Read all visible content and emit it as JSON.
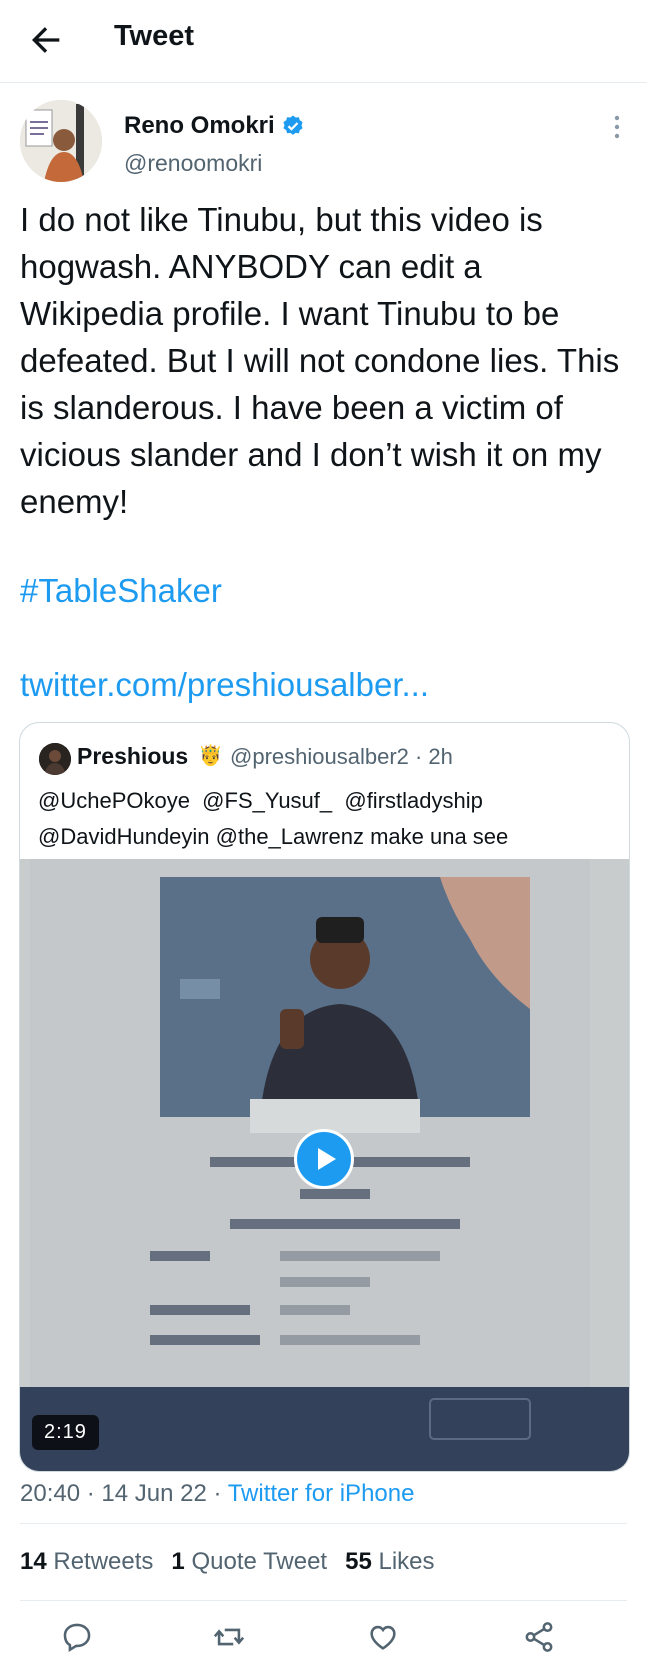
{
  "header": {
    "title": "Tweet"
  },
  "author": {
    "name": "Reno Omokri",
    "handle": "@renoomokri",
    "verified": true
  },
  "tweet": {
    "text": "I do not like Tinubu, but this video is hogwash. ANYBODY can edit a Wikipedia profile. I want Tinubu to be defeated. But I will not condone lies. This is slanderous. I have been a victim of vicious slander and I don’t wish it on my enemy!",
    "hashtag": "#TableShaker",
    "link": "twitter.com/preshiousalber..."
  },
  "quote": {
    "name": "Preshious",
    "handle_time": "@preshiousalber2 · 2h",
    "text": "@UchePOkoye  @FS_Yusuf_  @firstladyship\n@DavidHundeyin @the_Lawrenz make una see",
    "video_duration": "2:19"
  },
  "meta": {
    "time_date": "20:40 · 14 Jun 22 · ",
    "source": "Twitter for iPhone"
  },
  "stats": {
    "retweets_count": "14",
    "retweets_label": "Retweets",
    "quotes_count": "1",
    "quotes_label": "Quote Tweet",
    "likes_count": "55",
    "likes_label": "Likes"
  },
  "colors": {
    "accent": "#1d9bf0",
    "secondary_text": "#536471",
    "border": "#cfd9de"
  }
}
